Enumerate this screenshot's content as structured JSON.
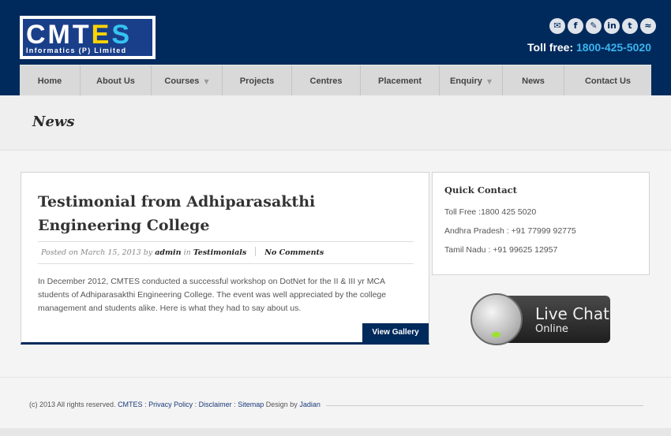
{
  "header": {
    "logo_text": "CMTES",
    "logo_sub": "Informatics (P) Limited",
    "tollfree_label": "Toll free:",
    "tollfree_number": "1800-425-5020",
    "social_icons": [
      {
        "name": "mail-icon",
        "glyph": "✉"
      },
      {
        "name": "facebook-icon",
        "glyph": "f"
      },
      {
        "name": "blog-icon",
        "glyph": "✎"
      },
      {
        "name": "linkedin-icon",
        "glyph": "in"
      },
      {
        "name": "twitter-icon",
        "glyph": "t"
      },
      {
        "name": "rss-icon",
        "glyph": "≈"
      }
    ]
  },
  "nav": {
    "items": [
      {
        "label": "Home"
      },
      {
        "label": "About Us"
      },
      {
        "label": "Courses",
        "dropdown": true
      },
      {
        "label": "Projects"
      },
      {
        "label": "Centres"
      },
      {
        "label": "Placement"
      },
      {
        "label": "Enquiry",
        "dropdown": true
      },
      {
        "label": "News"
      },
      {
        "label": "Contact Us"
      }
    ]
  },
  "page": {
    "title": "News"
  },
  "post": {
    "title": "Testimonial from Adhiparasakthi Engineering College",
    "meta_posted": "Posted on March 15, 2013 by",
    "meta_author": "admin",
    "meta_in": "in",
    "meta_category": "Testimonials",
    "meta_comments": "No Comments",
    "body": "In December 2012, CMTES conducted a successful workshop on DotNet for the II & III yr MCA students of Adhiparasakthi Engineering College. The event was well appreciated by the college management and students alike. Here is what they had to say about us.",
    "gallery_button": "View Gallery"
  },
  "sidebar": {
    "contact_title": "Quick Contact",
    "lines": [
      "Toll Free :1800 425 5020",
      "Andhra Pradesh : +91 77999 92775",
      "Tamil Nadu : +91 99625 12957"
    ],
    "livechat_line1": "Live Chat",
    "livechat_line2": "Online"
  },
  "footer": {
    "copyright": "(c) 2013 All rights reserved.",
    "cmtes": "CMTES",
    "sep1": ":",
    "privacy": "Privacy Policy",
    "sep2": ":",
    "disclaimer": "Disclaimer",
    "sep3": ":",
    "sitemap": "Sitemap",
    "design_by": "Design by",
    "designer": "Jadian"
  }
}
